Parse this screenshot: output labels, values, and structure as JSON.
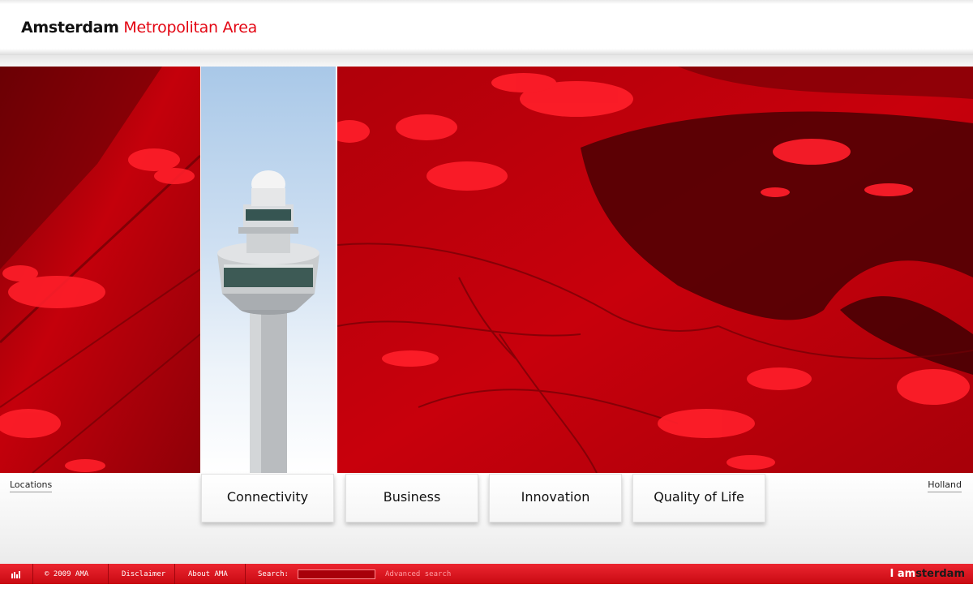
{
  "header": {
    "brand_bold": "Amsterdam",
    "brand_light": "Metropolitan Area"
  },
  "side": {
    "left_label": "Locations",
    "right_label": "Holland"
  },
  "nav": {
    "tabs": [
      {
        "label": "Connectivity"
      },
      {
        "label": "Business"
      },
      {
        "label": "Innovation"
      },
      {
        "label": "Quality of Life"
      }
    ]
  },
  "footer": {
    "icon": "bar-chart-icon",
    "copyright": "© 2009 AMA",
    "disclaimer": "Disclaimer",
    "about": "About AMA",
    "search_label": "Search:",
    "search_value": "",
    "advanced_search": "Advanced search",
    "logo_prefix": "I am",
    "logo_suffix": "sterdam"
  },
  "colors": {
    "accent": "#e30613",
    "footer_red": "#d8101a",
    "map_red": "#b5000a"
  }
}
